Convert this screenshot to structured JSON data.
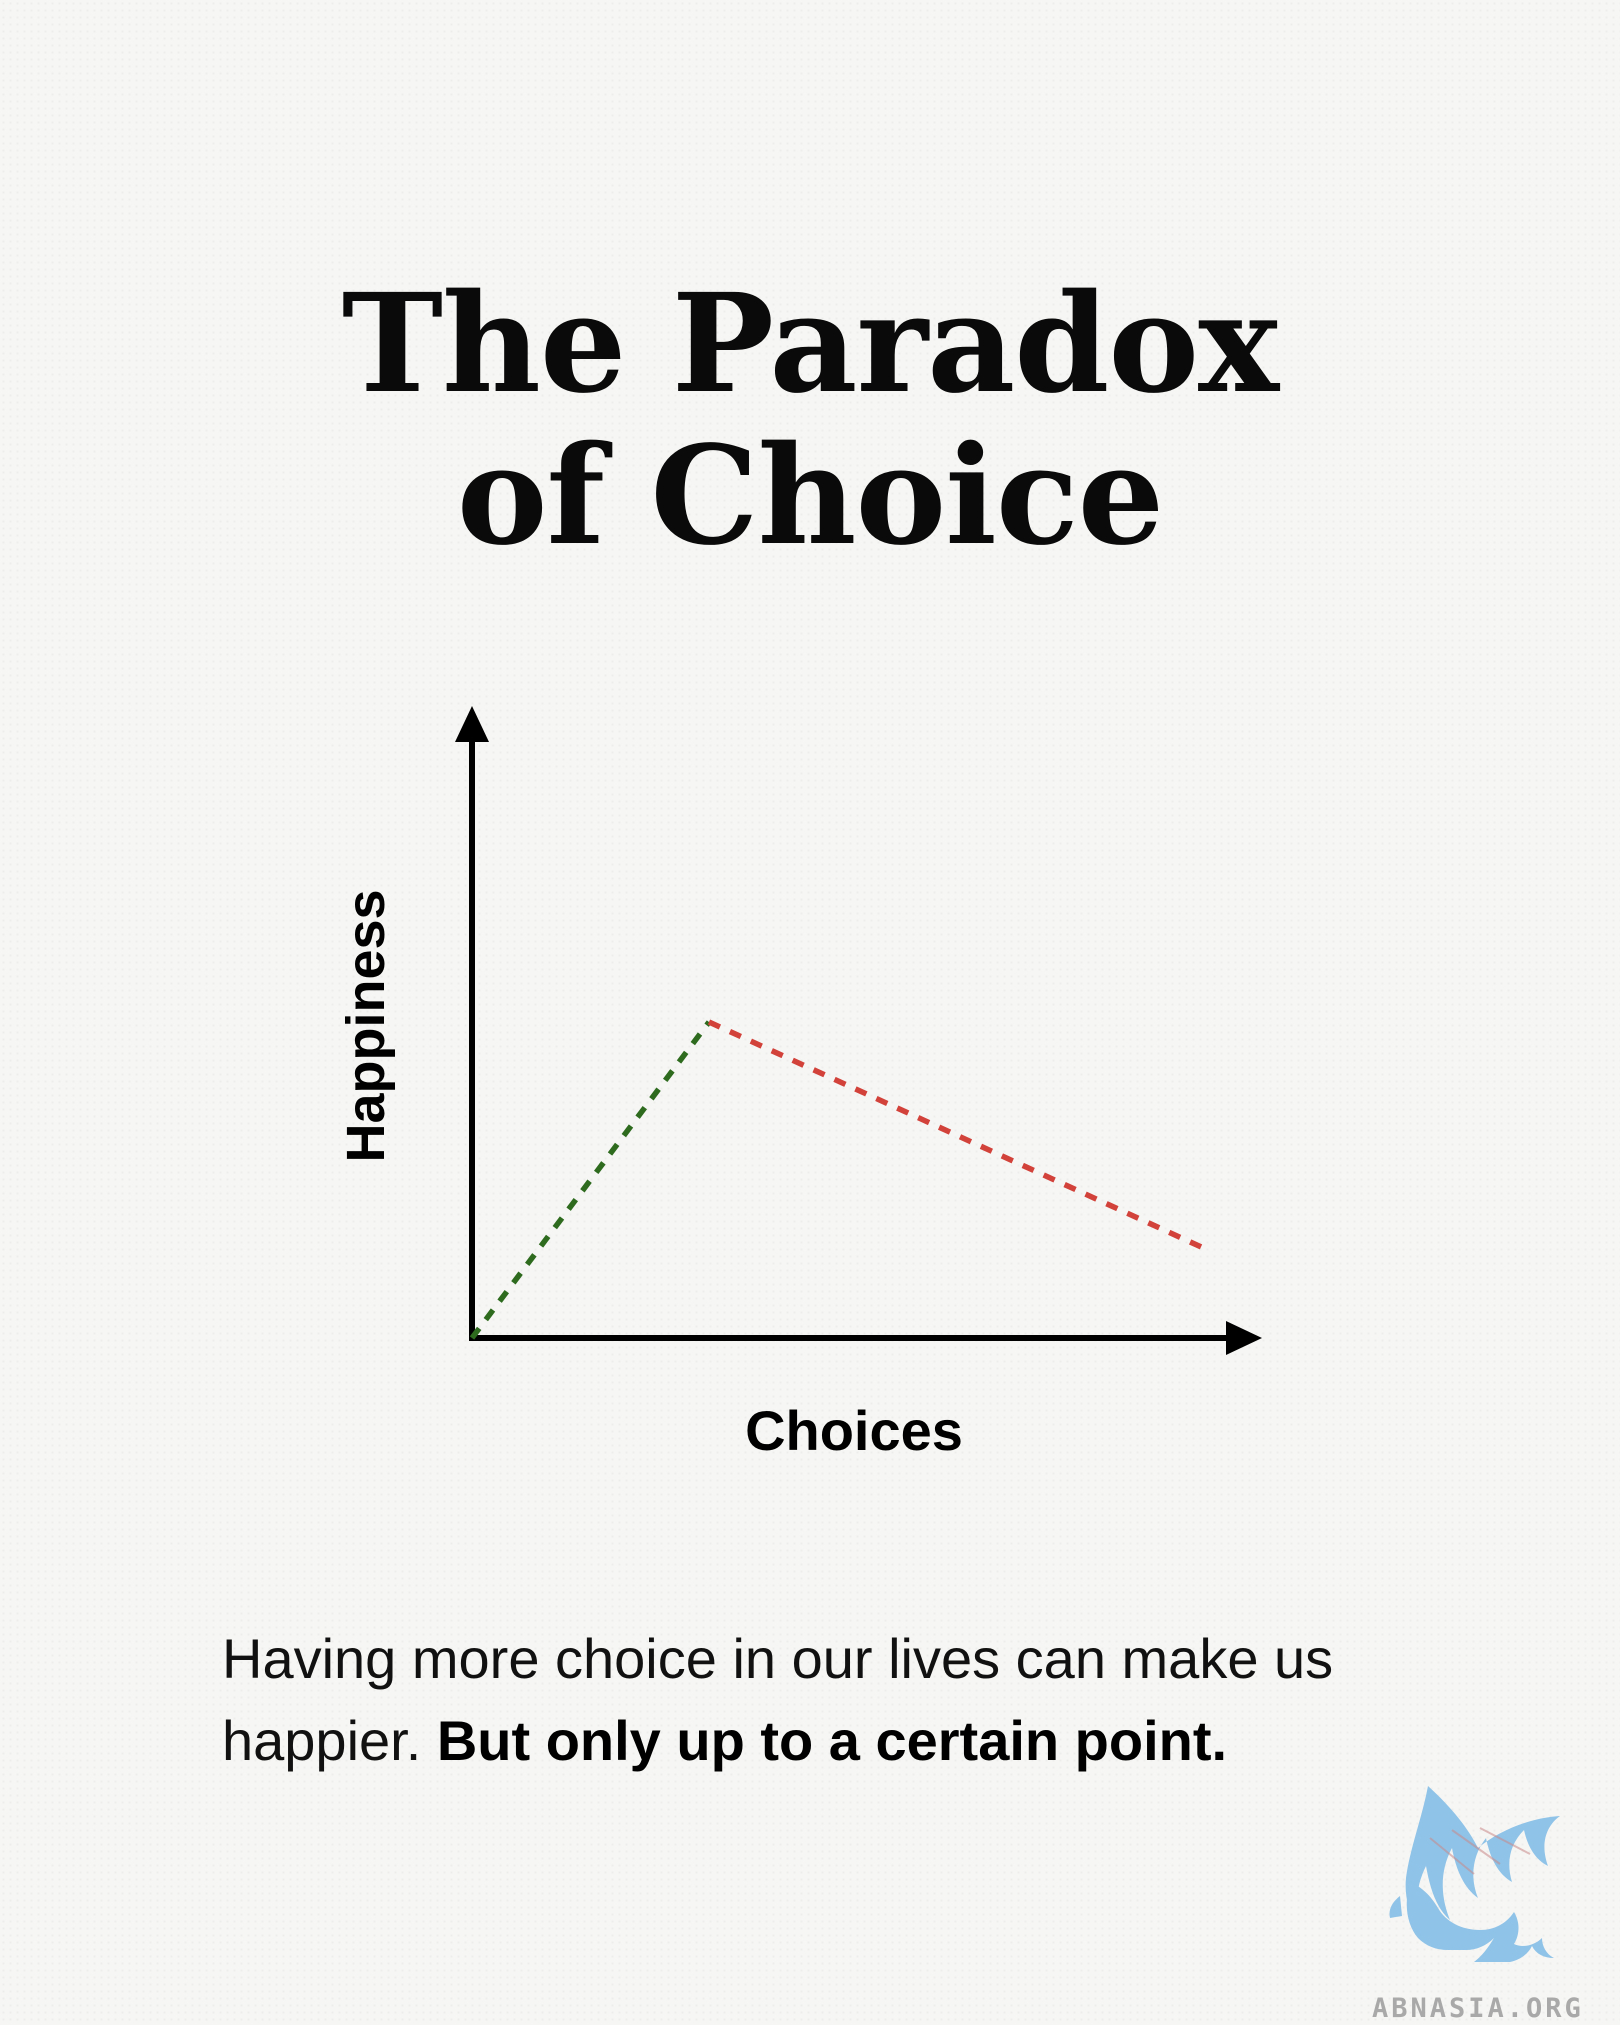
{
  "title": {
    "line1": "The Paradox",
    "line2": "of Choice"
  },
  "chart_data": {
    "type": "line",
    "xlabel": "Choices",
    "ylabel": "Happiness",
    "axis_ticks": false,
    "grid": false,
    "series": [
      {
        "values": [
          [
            0,
            0
          ],
          [
            30,
            50
          ]
        ],
        "color": "#2e6b1f",
        "style": "dashed"
      },
      {
        "values": [
          [
            30,
            50
          ],
          [
            93,
            14
          ]
        ],
        "color": "#d2413a",
        "style": "dashed"
      }
    ],
    "xlim": [
      0,
      100
    ],
    "ylim": [
      0,
      100
    ]
  },
  "caption": {
    "regular": "Having more choice in our lives can make us happier. ",
    "bold": "But only up to a certain point."
  },
  "logo": {
    "text": "ABNASIA.ORG",
    "color": "#8fc3e8"
  }
}
